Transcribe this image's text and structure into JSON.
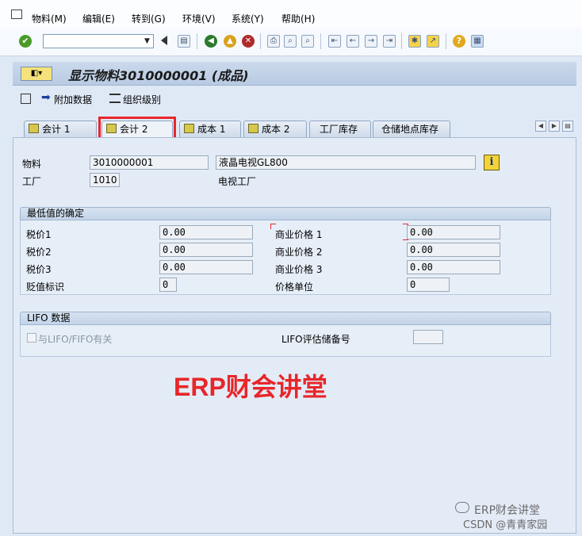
{
  "menu": {
    "items": [
      "物料(M)",
      "编辑(E)",
      "转到(G)",
      "环境(V)",
      "系统(Y)",
      "帮助(H)"
    ]
  },
  "toolbar": {
    "command_field_value": "",
    "icons": [
      "check-icon",
      "back-icon",
      "save-icon",
      "nav-back-icon",
      "exit-icon",
      "cancel-icon",
      "print-icon",
      "find-icon",
      "find-next-icon",
      "first-page-icon",
      "prev-page-icon",
      "next-page-icon",
      "last-page-icon",
      "new-session-icon",
      "shortcut-icon",
      "help-icon",
      "layout-icon"
    ]
  },
  "title": {
    "text": "显示物料3010000001 (成品)"
  },
  "app_toolbar": {
    "additional_data": "附加数据",
    "org_levels": "组织级别"
  },
  "tabs": [
    {
      "label": "会计 1",
      "active": false
    },
    {
      "label": "会计 2",
      "active": true
    },
    {
      "label": "成本 1",
      "active": false
    },
    {
      "label": "成本 2",
      "active": false
    },
    {
      "label": "工厂库存",
      "active": false
    },
    {
      "label": "仓储地点库存",
      "active": false
    }
  ],
  "header": {
    "material_label": "物料",
    "material_value": "3010000001",
    "material_desc": "液晶电视GL800",
    "plant_label": "工厂",
    "plant_value": "1010",
    "plant_desc": "电视工厂"
  },
  "lowest_value": {
    "title": "最低值的确定",
    "tax_price_1_label": "税价1",
    "tax_price_1": "0.00",
    "tax_price_2_label": "税价2",
    "tax_price_2": "0.00",
    "tax_price_3_label": "税价3",
    "tax_price_3": "0.00",
    "devaluation_label": "贬值标识",
    "devaluation": "0",
    "commercial_price_1_label": "商业价格 1",
    "commercial_price_1": "0.00",
    "commercial_price_2_label": "商业价格 2",
    "commercial_price_2": "0.00",
    "commercial_price_3_label": "商业价格 3",
    "commercial_price_3": "0.00",
    "price_unit_label": "价格单位",
    "price_unit": "0"
  },
  "lifo": {
    "title": "LIFO 数据",
    "relevant_label": "与LIFO/FIFO有关",
    "relevant_checked": false,
    "pool_label": "LIFO评估储备号",
    "pool_value": ""
  },
  "watermark": {
    "main": "ERP财会讲堂",
    "footer_1": "ERP财会讲堂",
    "footer_2": "CSDN @青青家园"
  },
  "colors": {
    "highlight": "#e8262a",
    "background": "#dfe9f5"
  }
}
